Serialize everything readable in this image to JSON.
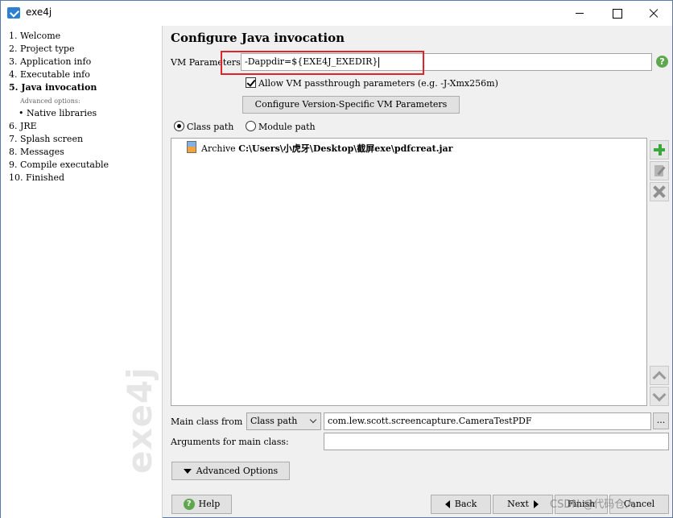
{
  "window": {
    "title": "exe4j",
    "accent": "#2d7fd3"
  },
  "steps": [
    {
      "label": "1.  Welcome"
    },
    {
      "label": "2.  Project type"
    },
    {
      "label": "3.  Application info"
    },
    {
      "label": "4.  Executable info"
    },
    {
      "label": "5.  Java invocation"
    },
    {
      "label": "Advanced options:"
    },
    {
      "label": "•  Native libraries"
    },
    {
      "label": "6.  JRE"
    },
    {
      "label": "7.  Splash screen"
    },
    {
      "label": "8.  Messages"
    },
    {
      "label": "9.  Compile executable"
    },
    {
      "label": "10.  Finished"
    }
  ],
  "watermark": "exe4j",
  "main": {
    "heading": "Configure Java invocation",
    "vm_label": "VM Parameters:",
    "vm_value": "-Dappdir=${EXE4J_EXEDIR}",
    "allow_label": "Allow VM passthrough parameters (e.g. -J-Xmx256m)",
    "configure_vm_button": "Configure Version-Specific VM Parameters",
    "classpath_radio": "Class path",
    "modulepath_radio": "Module path",
    "list": [
      {
        "prefix": "Archive ",
        "path": "C:\\Users\\小虎牙\\Desktop\\截屏exe\\pdfcreat.jar"
      }
    ],
    "main_class_label": "Main class from",
    "main_class_source": "Class path",
    "main_class_value": "com.lew.scott.screencapture.CameraTestPDF",
    "browse_label": "...",
    "args_label": "Arguments for main class:",
    "args_value": "",
    "advanced_button": "Advanced Options"
  },
  "footer": {
    "help": "Help",
    "back": "Back",
    "next": "Next",
    "finish": "Finish",
    "cancel": "Cancel"
  },
  "overlay_watermark": "CSDN @代码仓人",
  "colors": {
    "highlight": "#e0242b",
    "help_green": "#5fa84f",
    "add_green": "#3aa83a"
  }
}
